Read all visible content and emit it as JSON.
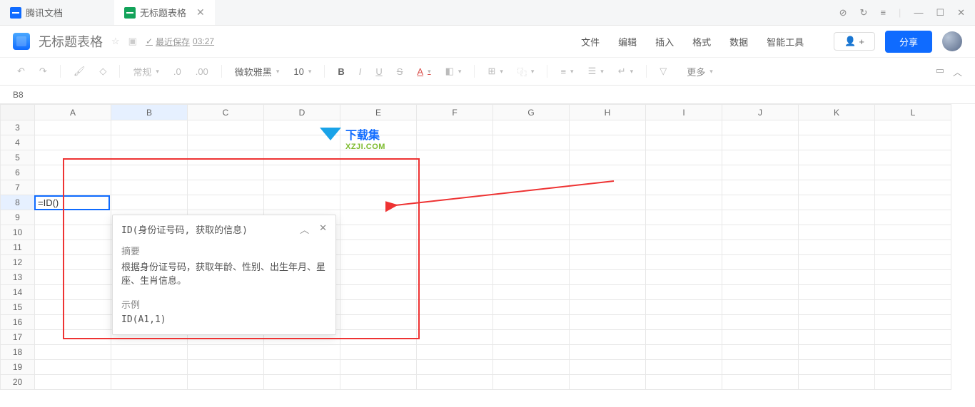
{
  "tabs": {
    "home": "腾讯文档",
    "active": "无标题表格"
  },
  "header": {
    "title": "无标题表格",
    "saved_prefix": "最近保存",
    "saved_time": "03:27",
    "menus": [
      "文件",
      "编辑",
      "插入",
      "格式",
      "数据",
      "智能工具"
    ],
    "share": "分享"
  },
  "toolbar": {
    "format": "常规",
    "dec1": ".0",
    "dec2": ".00",
    "font": "微软雅黑",
    "size": "10",
    "bold": "B",
    "italic": "I",
    "underline": "U",
    "strike": "S",
    "fontcolor": "A",
    "more": "更多"
  },
  "cellref": "B8",
  "columns": [
    "A",
    "B",
    "C",
    "D",
    "E",
    "F",
    "G",
    "H",
    "I",
    "J",
    "K",
    "L"
  ],
  "row_start": 3,
  "row_end": 20,
  "formula": "=ID()",
  "tooltip": {
    "signature": "ID(身份证号码, 获取的信息)",
    "summary_label": "摘要",
    "summary_text": "根据身份证号码，获取年龄、性别、出生年月、星座、生肖信息。",
    "example_label": "示例",
    "example_code": "ID(A1,1)"
  },
  "watermark": {
    "t1": "下载集",
    "t2": "XZJI.COM"
  }
}
